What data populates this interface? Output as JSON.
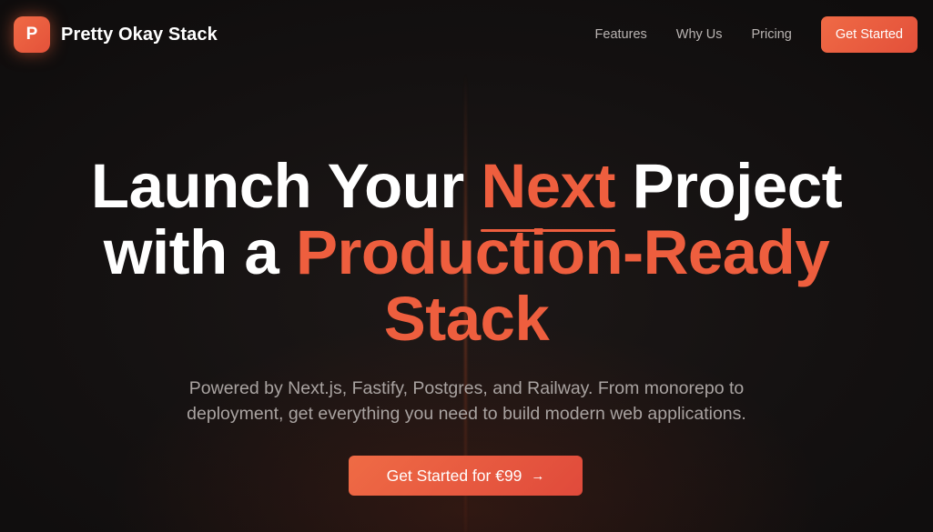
{
  "nav": {
    "logo_letter": "P",
    "brand": "Pretty Okay Stack",
    "links": [
      "Features",
      "Why Us",
      "Pricing"
    ],
    "cta": "Get Started"
  },
  "hero": {
    "title_line1_a": "Launch Your ",
    "title_line1_accent": "Next",
    "title_line1_b": " Project",
    "title_line2_a": "with a ",
    "title_line2_accent": "Production-Ready",
    "title_line3_accent": "Stack",
    "subtitle": "Powered by Next.js, Fastify, Postgres, and Railway. From monorepo to deployment, get everything you need to build modern web applications.",
    "cta_label": "Get Started for €99",
    "cta_arrow": "→"
  },
  "colors": {
    "accent": "#ee5e3e",
    "background": "#121010",
    "muted_text": "#a9a3a1"
  },
  "icons": {
    "logo": "p-letter-logo-icon",
    "cta": "arrow-right-icon"
  }
}
